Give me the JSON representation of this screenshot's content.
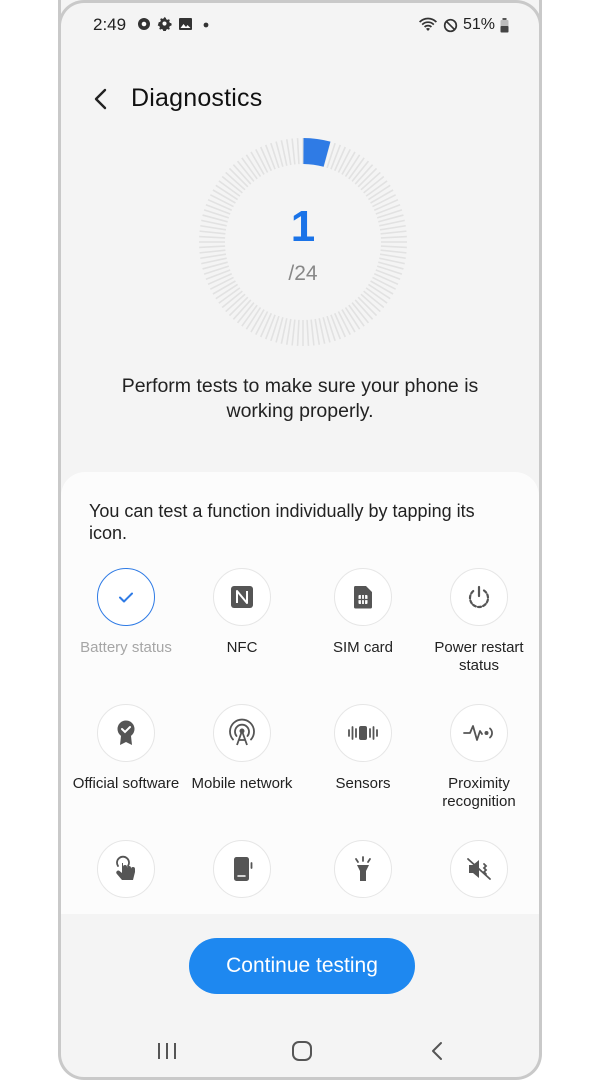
{
  "status_bar": {
    "time": "2:49",
    "battery": "51%"
  },
  "header": {
    "title": "Diagnostics"
  },
  "progress": {
    "current": "1",
    "total": "/24",
    "fraction": 0.0417,
    "accent": "#2f7be5"
  },
  "description": "Perform tests to make sure your phone is working properly.",
  "panel": {
    "instruction": "You can test a function individually by tapping its icon.",
    "tests": [
      {
        "label": "Battery status",
        "icon": "check-icon",
        "state": "done"
      },
      {
        "label": "NFC",
        "icon": "nfc-icon",
        "state": "pending"
      },
      {
        "label": "SIM card",
        "icon": "sim-card-icon",
        "state": "pending"
      },
      {
        "label": "Power restart status",
        "icon": "power-restart-icon",
        "state": "pending"
      },
      {
        "label": "Official software",
        "icon": "official-software-icon",
        "state": "pending"
      },
      {
        "label": "Mobile network",
        "icon": "mobile-network-icon",
        "state": "pending"
      },
      {
        "label": "Sensors",
        "icon": "sensors-icon",
        "state": "pending"
      },
      {
        "label": "Proximity recognition",
        "icon": "proximity-icon",
        "state": "pending"
      },
      {
        "label": "",
        "icon": "touch-icon",
        "state": "pending"
      },
      {
        "label": "",
        "icon": "phone-icon",
        "state": "pending"
      },
      {
        "label": "",
        "icon": "flashlight-icon",
        "state": "pending"
      },
      {
        "label": "",
        "icon": "speaker-mute-icon",
        "state": "pending"
      }
    ]
  },
  "cta": {
    "label": "Continue testing"
  }
}
